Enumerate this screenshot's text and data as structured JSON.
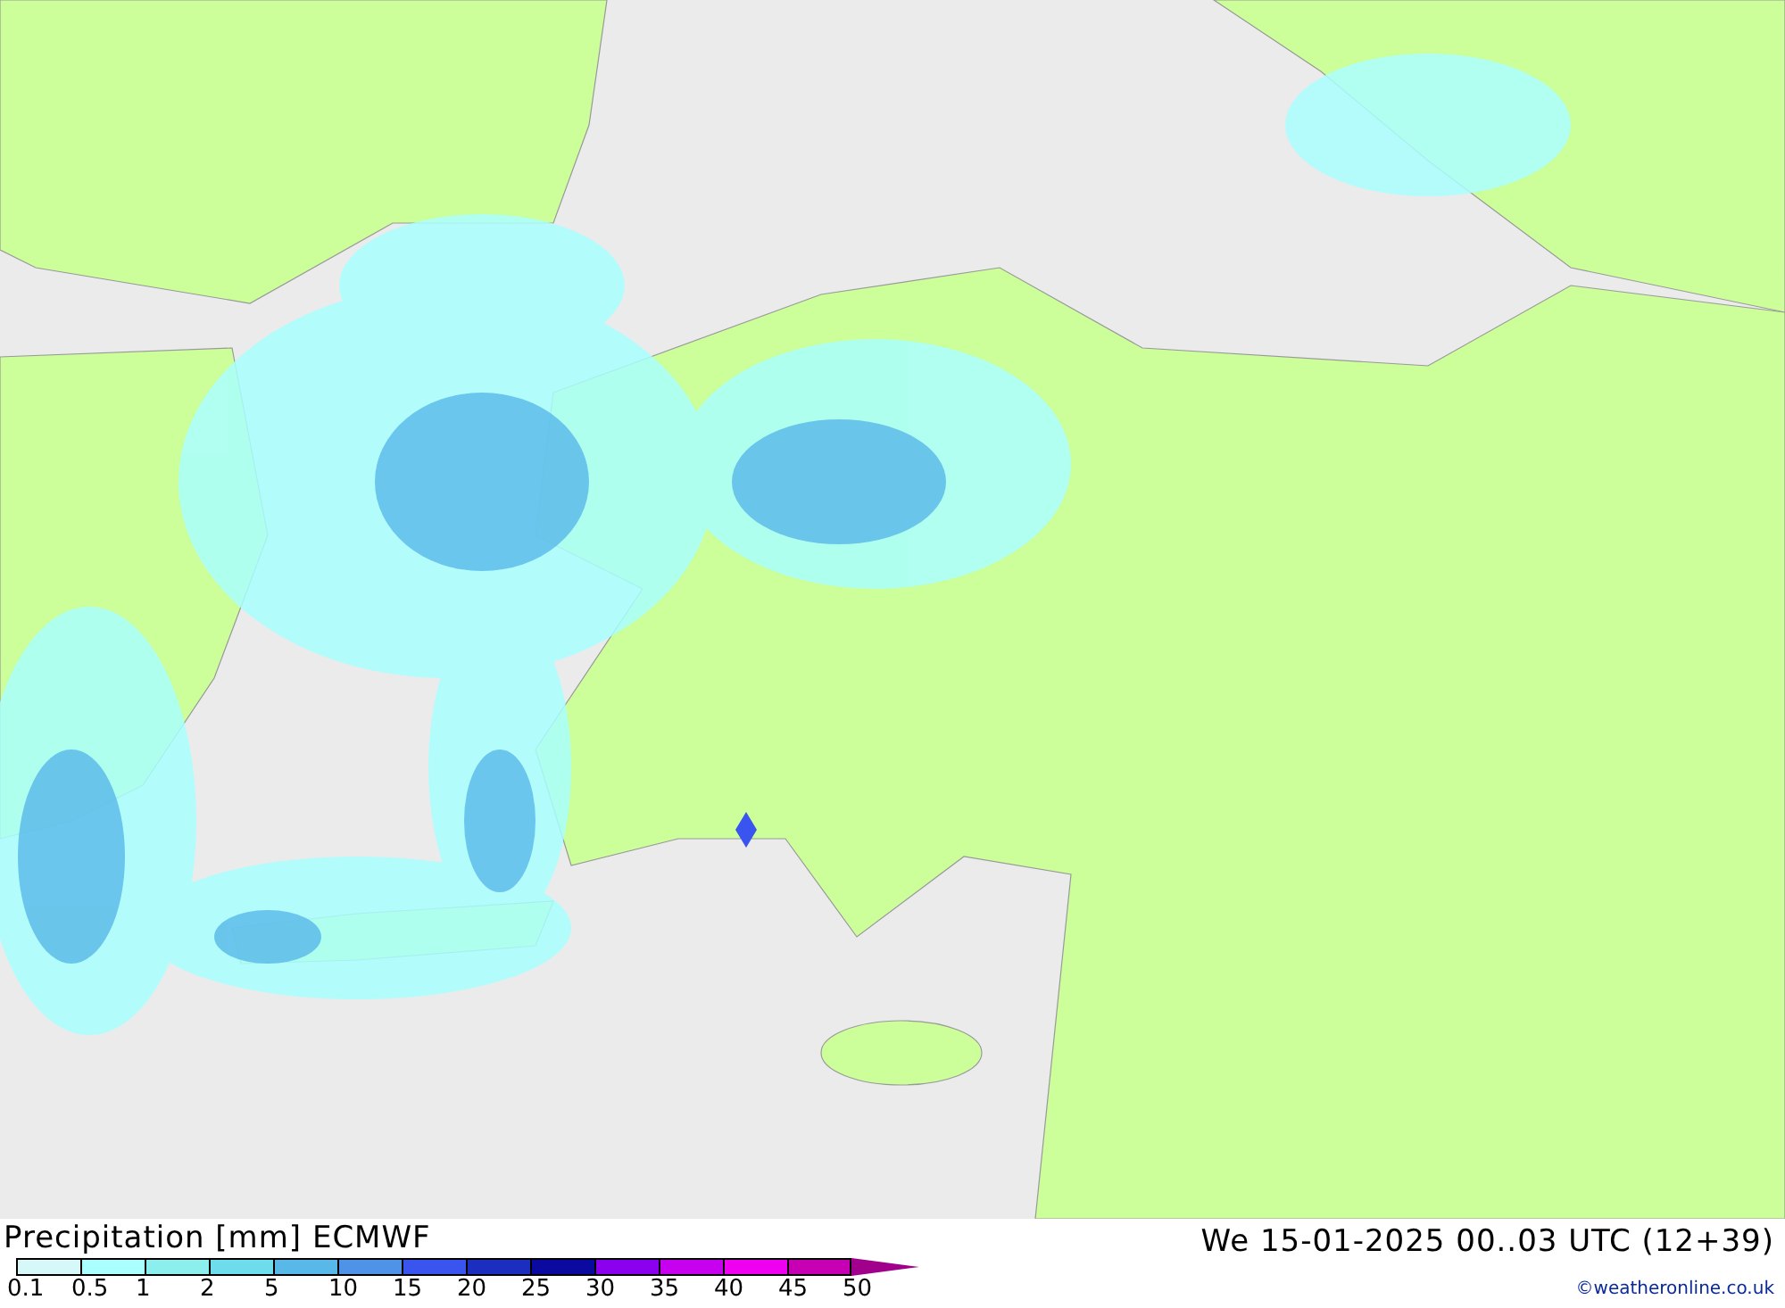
{
  "title": "Precipitation [mm] ECMWF",
  "valid_time": "We 15-01-2025 00..03 UTC (12+39)",
  "legend": [
    {
      "label": "0.1",
      "color": "#d6f8f8"
    },
    {
      "label": "0.5",
      "color": "#aaffff"
    },
    {
      "label": "1",
      "color": "#8deeee"
    },
    {
      "label": "2",
      "color": "#6ddcec"
    },
    {
      "label": "5",
      "color": "#58b8e8"
    },
    {
      "label": "10",
      "color": "#4f93e8"
    },
    {
      "label": "15",
      "color": "#3a54f0"
    },
    {
      "label": "20",
      "color": "#1b2ec0"
    },
    {
      "label": "25",
      "color": "#0a0aa0"
    },
    {
      "label": "30",
      "color": "#8c00f0"
    },
    {
      "label": "35",
      "color": "#c800f0"
    },
    {
      "label": "40",
      "color": "#f000f0"
    },
    {
      "label": "45",
      "color": "#c800b4"
    },
    {
      "label": "50",
      "color": "#a0008c"
    }
  ],
  "credit": "©weatheronline.co.uk"
}
